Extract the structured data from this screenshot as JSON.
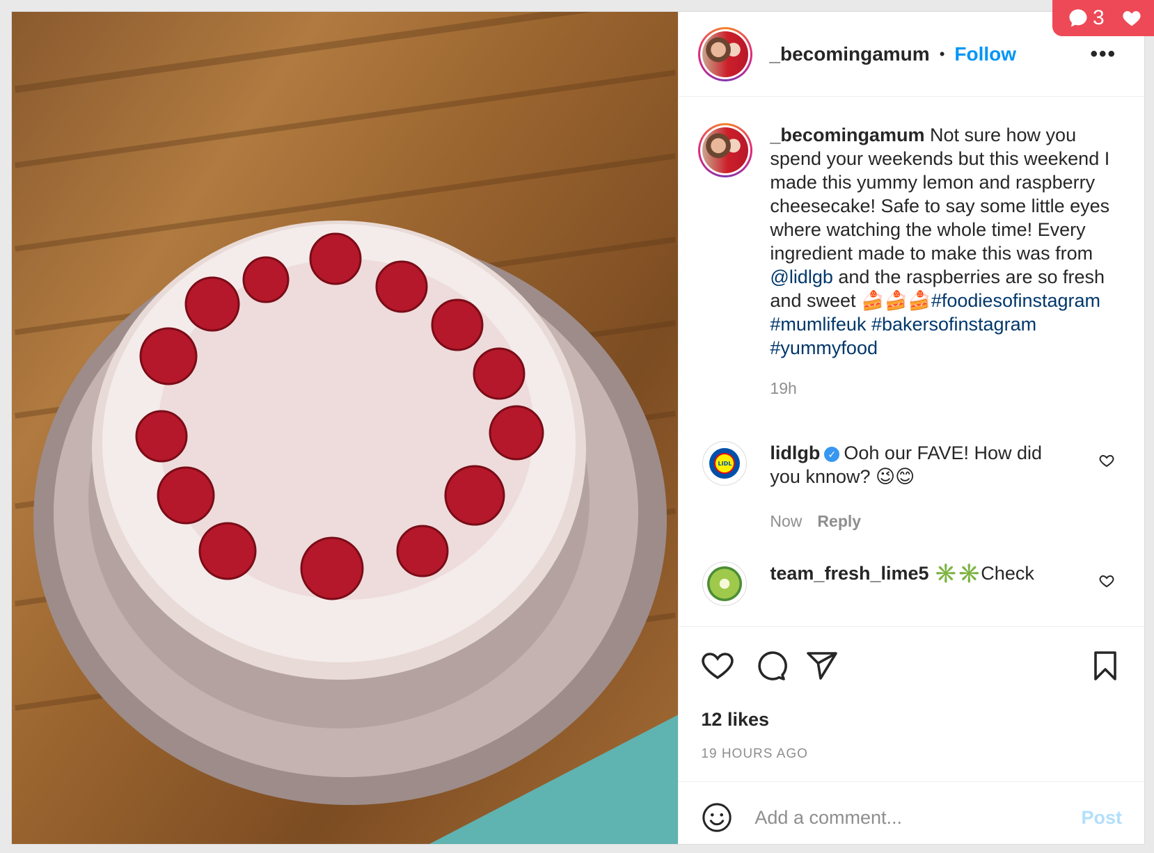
{
  "notifications": {
    "comment_count": "3"
  },
  "post": {
    "username": "_becomingamum",
    "follow_label": "Follow",
    "more_label": "•••",
    "caption": {
      "username": "_becomingamum",
      "text_1": "Not sure how you spend your weekends but this weekend I made this yummy lemon and raspberry cheesecake! Safe to say some little eyes where watching the whole time! Every ingredient made to make this was from ",
      "mention": "@lidlgb",
      "text_2": " and the raspberries are so fresh and sweet 🍰🍰🍰",
      "hashtags": "#foodiesofinstagram #mumlifeuk #bakersofinstagram #yummyfood",
      "time": "19h"
    },
    "comments": [
      {
        "username": "lidlgb",
        "verified": true,
        "text": "Ooh our FAVE! How did you knnow? 😉😊",
        "time": "Now",
        "reply_label": "Reply"
      },
      {
        "username": "team_fresh_lime5",
        "text": "✳️✳️Check"
      }
    ],
    "likes": "12 likes",
    "time_ago": "19 HOURS AGO",
    "add_comment_placeholder": "Add a comment...",
    "post_label": "Post"
  },
  "colors": {
    "accent": "#0095f6",
    "post_disabled": "#b2dffc",
    "notification": "#ed4956",
    "link": "#00376b"
  }
}
